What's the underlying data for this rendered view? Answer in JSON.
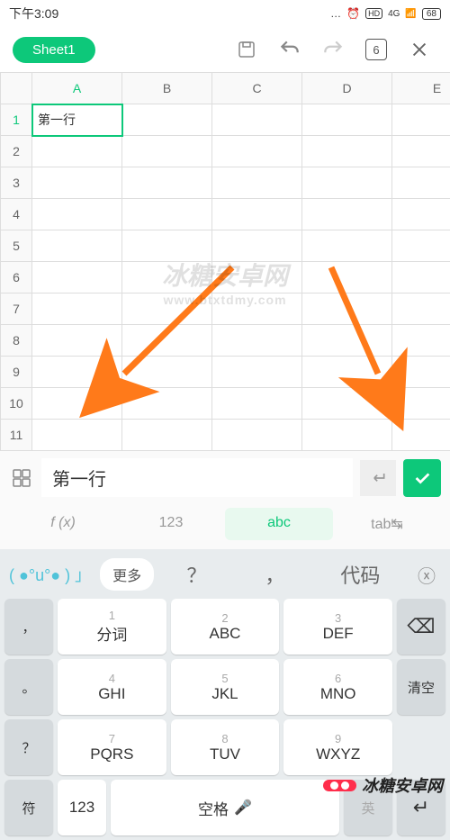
{
  "status": {
    "time": "下午3:09",
    "alarm": "⏰",
    "hd": "HD",
    "net": "4G",
    "sig": "📶",
    "battery": "68"
  },
  "toolbar": {
    "sheet_name": "Sheet1",
    "page_num": "6"
  },
  "sheet": {
    "cols": [
      "A",
      "B",
      "C",
      "D",
      "E"
    ],
    "rows": [
      "1",
      "2",
      "3",
      "4",
      "5",
      "6",
      "7",
      "8",
      "9",
      "10",
      "11"
    ],
    "active_col": 0,
    "active_row": 0,
    "cell_value": "第一行"
  },
  "input": {
    "value": "第一行"
  },
  "modes": {
    "fx": "f (x)",
    "num": "123",
    "abc": "abc",
    "tab": "tab↹"
  },
  "kbd": {
    "emoji": "( ●°u°● ) 」",
    "more": "更多",
    "syms": [
      "？",
      "，"
    ],
    "code": "代码",
    "del": "ⓧ",
    "keys": [
      {
        "n": "1",
        "l": "分词"
      },
      {
        "n": "2",
        "l": "ABC"
      },
      {
        "n": "3",
        "l": "DEF"
      },
      {
        "n": "4",
        "l": "GHI"
      },
      {
        "n": "5",
        "l": "JKL"
      },
      {
        "n": "6",
        "l": "MNO"
      },
      {
        "n": "7",
        "l": "PQRS"
      },
      {
        "n": "8",
        "l": "TUV"
      },
      {
        "n": "9",
        "l": "WXYZ"
      }
    ],
    "side_left": [
      "，",
      "。",
      "？"
    ],
    "side_right_del": "⌫",
    "side_right_clear": "清空",
    "side_right_ret": "↵",
    "bottom": {
      "sym": "符",
      "num": "123",
      "space": "空格",
      "lang": "英"
    }
  },
  "watermark": {
    "main": "冰糖安卓网",
    "sub": "www.btxtdmy.com"
  },
  "brand": "冰糖安卓网"
}
